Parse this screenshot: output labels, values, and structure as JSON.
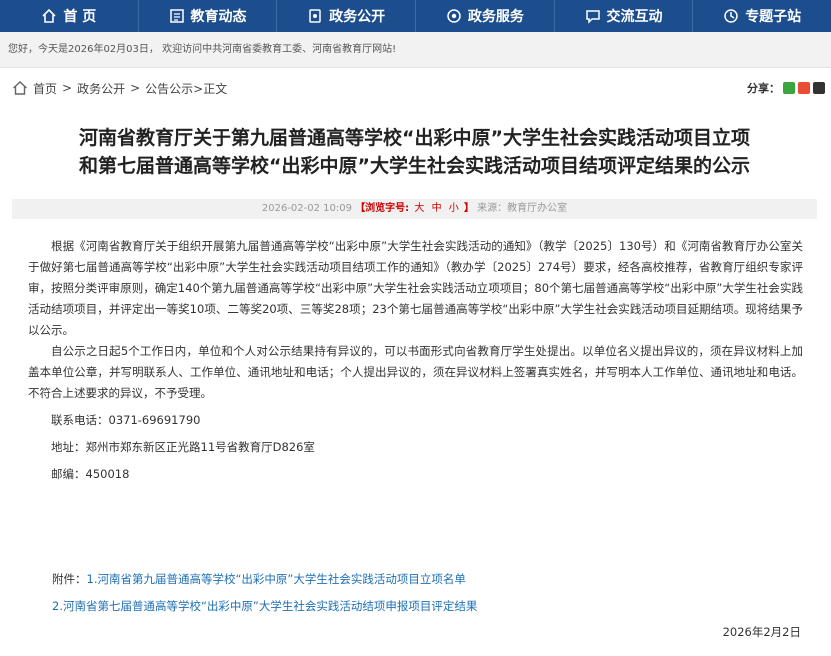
{
  "nav": {
    "items": [
      {
        "label": "首 页",
        "icon": "home-icon"
      },
      {
        "label": "教育动态",
        "icon": "news-icon"
      },
      {
        "label": "政务公开",
        "icon": "document-icon"
      },
      {
        "label": "政务服务",
        "icon": "service-icon"
      },
      {
        "label": "交流互动",
        "icon": "chat-icon"
      },
      {
        "label": "专题子站",
        "icon": "topic-icon"
      }
    ]
  },
  "welcome": {
    "text": "您好，今天是2026年02月03日， 欢迎访问中共河南省委教育工委、河南省教育厅网站!"
  },
  "breadcrumb": {
    "home": "首页",
    "sep": ">",
    "level1": "政务公开",
    "level2": "公告公示",
    "current": ">正文"
  },
  "share": {
    "label": "分享：",
    "colors": {
      "wechat": "#3aa53a",
      "weibo": "#e94b35",
      "qq": "#333333"
    }
  },
  "article": {
    "title_line1": "河南省教育厅关于第九届普通高等学校“出彩中原”大学生社会实践活动项目立项",
    "title_line2": "和第七届普通高等学校“出彩中原”大学生社会实践活动项目结项评定结果的公示",
    "meta_date": "2026-02-02 10:09",
    "meta_font_label": "【浏览字号:",
    "font_large": "大",
    "font_medium": "中",
    "font_small": "小",
    "meta_font_close": "】",
    "meta_source": "来源：教育厅办公室",
    "para1": "根据《河南省教育厅关于组织开展第九届普通高等学校“出彩中原”大学生社会实践活动的通知》（教学〔2025〕130号）和《河南省教育厅办公室关于做好第七届普通高等学校“出彩中原”大学生社会实践活动项目结项工作的通知》（教办学〔2025〕274号）要求，经各高校推荐，省教育厅组织专家评审，按照分类评审原则，确定140个第九届普通高等学校“出彩中原”大学生社会实践活动立项项目；80个第七届普通高等学校“出彩中原”大学生社会实践活动结项项目，并评定出一等奖10项、二等奖20项、三等奖28项；23个第七届普通高等学校“出彩中原”大学生社会实践活动项目延期结项。现将结果予以公示。",
    "para2": "自公示之日起5个工作日内，单位和个人对公示结果持有异议的，可以书面形式向省教育厅学生处提出。以单位名义提出异议的，须在异议材料上加盖本单位公章，并写明联系人、工作单位、通讯地址和电话；个人提出异议的，须在异议材料上签署真实姓名，并写明本人工作单位、通讯地址和电话。不符合上述要求的异议，不予受理。",
    "phone": "联系电话：0371-69691790",
    "address": "地址：郑州市郑东新区正光路11号省教育厅D826室",
    "postcode": "邮编：450018",
    "attach_label": "附件：",
    "attach1": "1.河南省第九届普通高等学校“出彩中原”大学生社会实践活动项目立项名单",
    "attach2": "2.河南省第七届普通高等学校“出彩中原”大学生社会实践活动结项申报项目评定结果",
    "sign_date": "2026年2月2日"
  }
}
